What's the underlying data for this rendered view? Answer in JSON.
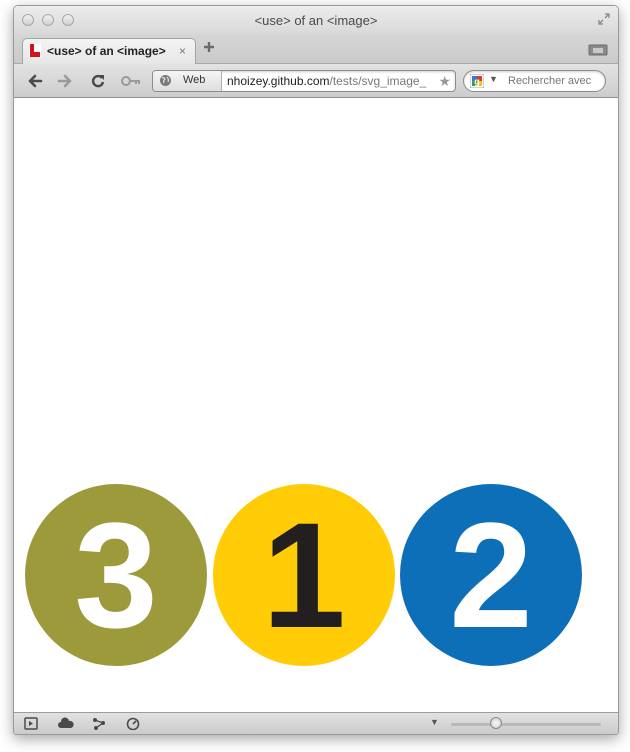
{
  "window": {
    "title": "<use> of an <image>"
  },
  "tab": {
    "title": "<use> of an <image>",
    "close_glyph": "×"
  },
  "toolbar": {
    "web_label": "Web",
    "url_host": "nhoizey.github.com",
    "url_prefix": "",
    "url_path": "/tests/svg_image_",
    "search_placeholder": "Rechercher avec",
    "star_glyph": "★"
  },
  "content": {
    "circles": [
      {
        "digit": "3",
        "fill": "#9c9a3a",
        "digit_color": "#ffffff"
      },
      {
        "digit": "1",
        "fill": "#ffcc06",
        "digit_color": "#231f20"
      },
      {
        "digit": "2",
        "fill": "#0d6fb8",
        "digit_color": "#ffffff"
      }
    ]
  },
  "icons": {
    "back": "back-arrow-icon",
    "forward": "forward-arrow-icon",
    "reload": "reload-icon",
    "key": "key-icon",
    "globe": "globe-icon",
    "search_engine": "google-icon",
    "new_tab": "plus-icon",
    "status": [
      "panel-icon",
      "cloud-icon",
      "share-icon",
      "speed-dial-icon"
    ]
  }
}
